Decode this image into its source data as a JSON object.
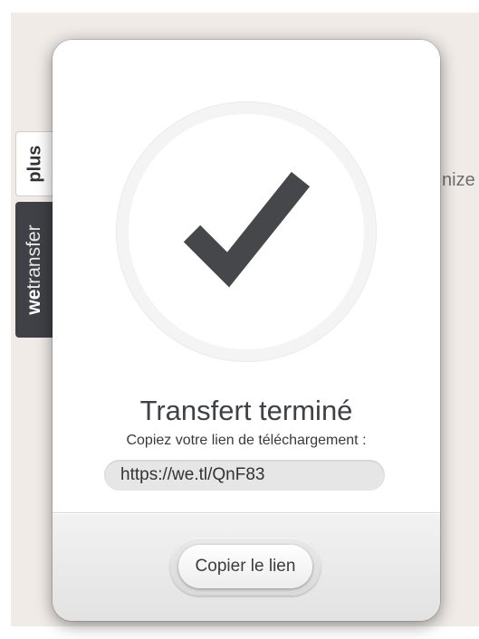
{
  "background": {
    "partial_text": "nize"
  },
  "side_tabs": {
    "plus_label": "plus",
    "brand_prefix": "we",
    "brand_suffix": "transfer"
  },
  "dialog": {
    "status_icon": "checkmark-icon",
    "title": "Transfert terminé",
    "subtitle": "Copiez votre lien de téléchargement :",
    "link": "https://we.tl/QnF83",
    "copy_button_label": "Copier le lien"
  },
  "colors": {
    "dark_brand": "#3f4146",
    "panel_bg": "#ffffff",
    "page_bg": "#f1ebe8",
    "checkmark": "#46474b"
  }
}
